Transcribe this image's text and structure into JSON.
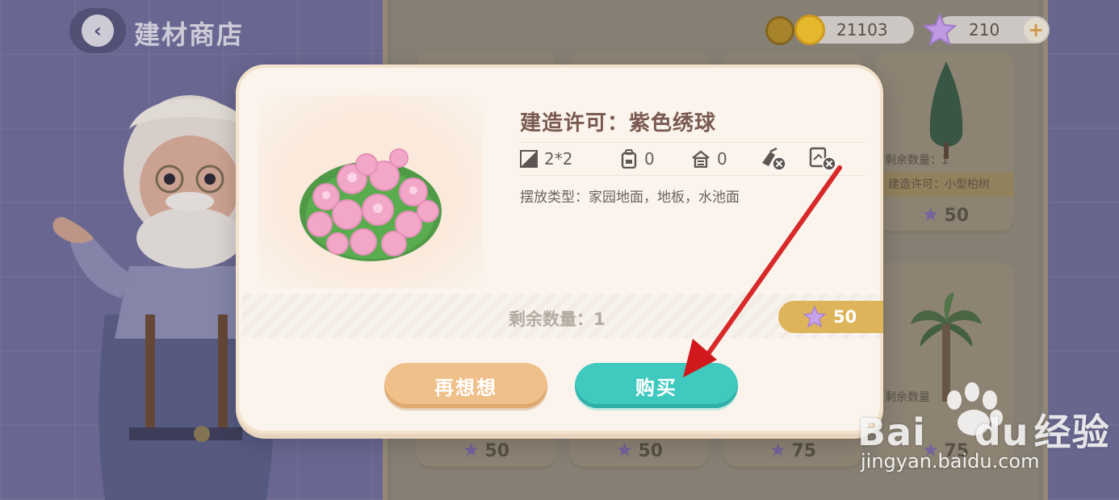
{
  "header": {
    "title": "建材商店",
    "back_icon": "chevron-left-icon"
  },
  "currency": {
    "coins": "21103",
    "stars": "210",
    "add_label": "+"
  },
  "background_cards": [
    {
      "band_text": "建造许可：小型柏树",
      "remain_text": "剩余数量：1",
      "price": "50"
    },
    {
      "band_text": "",
      "remain_text": "剩余数量",
      "price": "75"
    },
    {
      "price": "50"
    },
    {
      "price": "50"
    },
    {
      "price": "75"
    }
  ],
  "modal": {
    "item_name": "建造许可：紫色绣球",
    "stats": {
      "size": "2*2",
      "bag_count": "0",
      "house_count": "0"
    },
    "placement_text": "摆放类型：家园地面，地板，水池面",
    "remaining_text": "剩余数量：1",
    "price": "50",
    "rethink_label": "再想想",
    "buy_label": "购买"
  },
  "watermark": {
    "brand": "Bai",
    "brand_tail": "du",
    "brand_cn": "经验",
    "url": "jingyan.baidu.com"
  },
  "colors": {
    "modal_bg": "#faf4ec",
    "buy_button": "#3fc9bf",
    "rethink_button": "#f0c08b",
    "price_tag": "#ddb45a",
    "arrow": "#e0161c"
  }
}
